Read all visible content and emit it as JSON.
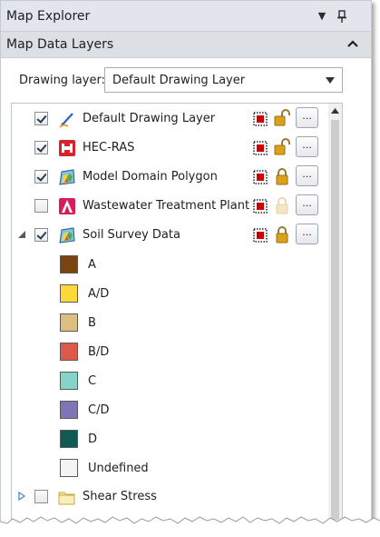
{
  "window": {
    "title": "Map Explorer",
    "menu_arrow": "▼",
    "pin_icon": "pin-icon"
  },
  "section": {
    "title": "Map Data Layers"
  },
  "drawing_layer": {
    "label": "Drawing layer:",
    "value": "Default Drawing Layer"
  },
  "layers": [
    {
      "label": "Default Drawing Layer",
      "checked": true,
      "icon": "pencil-icon",
      "expander": "none",
      "locked": false,
      "has_controls": true,
      "more_label": "..."
    },
    {
      "label": "HEC-RAS",
      "checked": true,
      "icon": "hec-ras-icon",
      "expander": "none",
      "locked": false,
      "has_controls": true,
      "more_label": "..."
    },
    {
      "label": "Model Domain Polygon",
      "checked": true,
      "icon": "polygon-map-icon",
      "expander": "none",
      "locked": true,
      "has_controls": true,
      "more_label": "..."
    },
    {
      "label": "Wastewater Treatment Plant",
      "checked": false,
      "icon": "point-layer-icon",
      "expander": "none",
      "locked": true,
      "lock_faded": true,
      "has_controls": true,
      "more_label": "..."
    },
    {
      "label": "Soil Survey Data",
      "checked": true,
      "icon": "polygon-map-icon",
      "expander": "expanded",
      "locked": true,
      "has_controls": true,
      "more_label": "..."
    },
    {
      "label": "Shear Stress",
      "checked": false,
      "icon": "folder-icon",
      "expander": "collapsed",
      "has_controls": false
    }
  ],
  "soil_legend": [
    {
      "label": "A",
      "color": "#7a4411"
    },
    {
      "label": "A/D",
      "color": "#ffd83a"
    },
    {
      "label": "B",
      "color": "#dcbd82"
    },
    {
      "label": "B/D",
      "color": "#dd5a4b"
    },
    {
      "label": "C",
      "color": "#86d3c9"
    },
    {
      "label": "C/D",
      "color": "#8074b4"
    },
    {
      "label": "D",
      "color": "#0f5a52"
    },
    {
      "label": "Undefined",
      "color": "#f4f4f4"
    }
  ],
  "colors": {
    "titlebar": "#e2e6ec",
    "header": "#dcdfe4",
    "checkmark": "#2a3a52",
    "layer_dots_fill": "#cc0000",
    "lock_gold": "#d9a21a"
  }
}
